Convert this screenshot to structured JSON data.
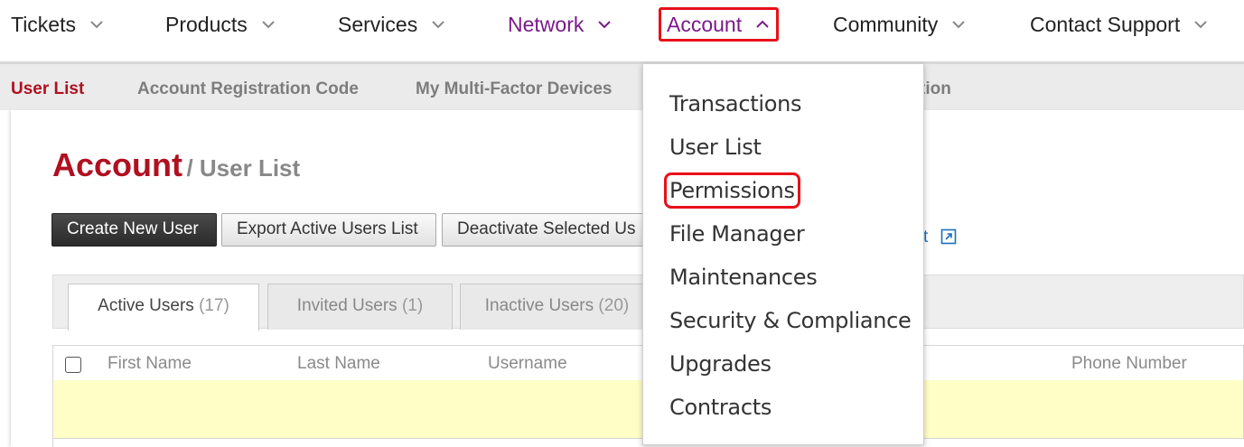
{
  "topnav": {
    "items": [
      {
        "label": "Tickets"
      },
      {
        "label": "Products"
      },
      {
        "label": "Services"
      },
      {
        "label": "Network"
      },
      {
        "label": "Account"
      },
      {
        "label": "Community"
      },
      {
        "label": "Contact Support"
      }
    ]
  },
  "subnav": {
    "items": [
      {
        "label": "User List"
      },
      {
        "label": "Account Registration Code"
      },
      {
        "label": "My Multi-Factor Devices"
      },
      {
        "label": "tion"
      }
    ]
  },
  "page": {
    "title": "Account",
    "subtitle": "/ User List"
  },
  "buttons": {
    "create": "Create New User",
    "export": "Export Active Users List",
    "deactivate": "Deactivate Selected Us"
  },
  "ext_link": "t",
  "tabs": [
    {
      "label": "Active Users",
      "count": "(17)"
    },
    {
      "label": "Invited Users",
      "count": "(1)"
    },
    {
      "label": "Inactive Users",
      "count": "(20)"
    }
  ],
  "table": {
    "columns": [
      "First Name",
      "Last Name",
      "Username",
      "Phone Number"
    ]
  },
  "dropdown": {
    "items": [
      {
        "label": "Transactions"
      },
      {
        "label": "User List"
      },
      {
        "label": "Permissions"
      },
      {
        "label": "File Manager"
      },
      {
        "label": "Maintenances"
      },
      {
        "label": "Security & Compliance"
      },
      {
        "label": "Upgrades"
      },
      {
        "label": "Contracts"
      }
    ]
  },
  "colors": {
    "brand_red": "#b01020",
    "highlight_red": "#e8101a",
    "nav_purple": "#7a1a8a",
    "row_yellow": "#fffec6"
  }
}
